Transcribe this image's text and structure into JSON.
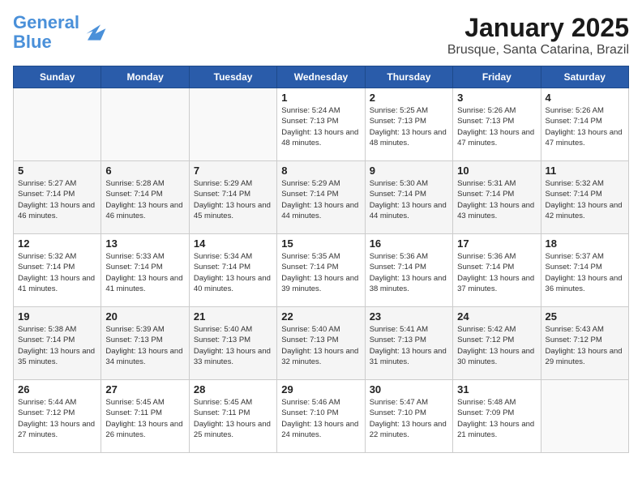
{
  "header": {
    "logo_line1": "General",
    "logo_line2": "Blue",
    "calendar_title": "January 2025",
    "calendar_subtitle": "Brusque, Santa Catarina, Brazil"
  },
  "weekdays": [
    "Sunday",
    "Monday",
    "Tuesday",
    "Wednesday",
    "Thursday",
    "Friday",
    "Saturday"
  ],
  "weeks": [
    [
      {
        "day": "",
        "sunrise": "",
        "sunset": "",
        "daylight": ""
      },
      {
        "day": "",
        "sunrise": "",
        "sunset": "",
        "daylight": ""
      },
      {
        "day": "",
        "sunrise": "",
        "sunset": "",
        "daylight": ""
      },
      {
        "day": "1",
        "sunrise": "Sunrise: 5:24 AM",
        "sunset": "Sunset: 7:13 PM",
        "daylight": "Daylight: 13 hours and 48 minutes."
      },
      {
        "day": "2",
        "sunrise": "Sunrise: 5:25 AM",
        "sunset": "Sunset: 7:13 PM",
        "daylight": "Daylight: 13 hours and 48 minutes."
      },
      {
        "day": "3",
        "sunrise": "Sunrise: 5:26 AM",
        "sunset": "Sunset: 7:13 PM",
        "daylight": "Daylight: 13 hours and 47 minutes."
      },
      {
        "day": "4",
        "sunrise": "Sunrise: 5:26 AM",
        "sunset": "Sunset: 7:14 PM",
        "daylight": "Daylight: 13 hours and 47 minutes."
      }
    ],
    [
      {
        "day": "5",
        "sunrise": "Sunrise: 5:27 AM",
        "sunset": "Sunset: 7:14 PM",
        "daylight": "Daylight: 13 hours and 46 minutes."
      },
      {
        "day": "6",
        "sunrise": "Sunrise: 5:28 AM",
        "sunset": "Sunset: 7:14 PM",
        "daylight": "Daylight: 13 hours and 46 minutes."
      },
      {
        "day": "7",
        "sunrise": "Sunrise: 5:29 AM",
        "sunset": "Sunset: 7:14 PM",
        "daylight": "Daylight: 13 hours and 45 minutes."
      },
      {
        "day": "8",
        "sunrise": "Sunrise: 5:29 AM",
        "sunset": "Sunset: 7:14 PM",
        "daylight": "Daylight: 13 hours and 44 minutes."
      },
      {
        "day": "9",
        "sunrise": "Sunrise: 5:30 AM",
        "sunset": "Sunset: 7:14 PM",
        "daylight": "Daylight: 13 hours and 44 minutes."
      },
      {
        "day": "10",
        "sunrise": "Sunrise: 5:31 AM",
        "sunset": "Sunset: 7:14 PM",
        "daylight": "Daylight: 13 hours and 43 minutes."
      },
      {
        "day": "11",
        "sunrise": "Sunrise: 5:32 AM",
        "sunset": "Sunset: 7:14 PM",
        "daylight": "Daylight: 13 hours and 42 minutes."
      }
    ],
    [
      {
        "day": "12",
        "sunrise": "Sunrise: 5:32 AM",
        "sunset": "Sunset: 7:14 PM",
        "daylight": "Daylight: 13 hours and 41 minutes."
      },
      {
        "day": "13",
        "sunrise": "Sunrise: 5:33 AM",
        "sunset": "Sunset: 7:14 PM",
        "daylight": "Daylight: 13 hours and 41 minutes."
      },
      {
        "day": "14",
        "sunrise": "Sunrise: 5:34 AM",
        "sunset": "Sunset: 7:14 PM",
        "daylight": "Daylight: 13 hours and 40 minutes."
      },
      {
        "day": "15",
        "sunrise": "Sunrise: 5:35 AM",
        "sunset": "Sunset: 7:14 PM",
        "daylight": "Daylight: 13 hours and 39 minutes."
      },
      {
        "day": "16",
        "sunrise": "Sunrise: 5:36 AM",
        "sunset": "Sunset: 7:14 PM",
        "daylight": "Daylight: 13 hours and 38 minutes."
      },
      {
        "day": "17",
        "sunrise": "Sunrise: 5:36 AM",
        "sunset": "Sunset: 7:14 PM",
        "daylight": "Daylight: 13 hours and 37 minutes."
      },
      {
        "day": "18",
        "sunrise": "Sunrise: 5:37 AM",
        "sunset": "Sunset: 7:14 PM",
        "daylight": "Daylight: 13 hours and 36 minutes."
      }
    ],
    [
      {
        "day": "19",
        "sunrise": "Sunrise: 5:38 AM",
        "sunset": "Sunset: 7:14 PM",
        "daylight": "Daylight: 13 hours and 35 minutes."
      },
      {
        "day": "20",
        "sunrise": "Sunrise: 5:39 AM",
        "sunset": "Sunset: 7:13 PM",
        "daylight": "Daylight: 13 hours and 34 minutes."
      },
      {
        "day": "21",
        "sunrise": "Sunrise: 5:40 AM",
        "sunset": "Sunset: 7:13 PM",
        "daylight": "Daylight: 13 hours and 33 minutes."
      },
      {
        "day": "22",
        "sunrise": "Sunrise: 5:40 AM",
        "sunset": "Sunset: 7:13 PM",
        "daylight": "Daylight: 13 hours and 32 minutes."
      },
      {
        "day": "23",
        "sunrise": "Sunrise: 5:41 AM",
        "sunset": "Sunset: 7:13 PM",
        "daylight": "Daylight: 13 hours and 31 minutes."
      },
      {
        "day": "24",
        "sunrise": "Sunrise: 5:42 AM",
        "sunset": "Sunset: 7:12 PM",
        "daylight": "Daylight: 13 hours and 30 minutes."
      },
      {
        "day": "25",
        "sunrise": "Sunrise: 5:43 AM",
        "sunset": "Sunset: 7:12 PM",
        "daylight": "Daylight: 13 hours and 29 minutes."
      }
    ],
    [
      {
        "day": "26",
        "sunrise": "Sunrise: 5:44 AM",
        "sunset": "Sunset: 7:12 PM",
        "daylight": "Daylight: 13 hours and 27 minutes."
      },
      {
        "day": "27",
        "sunrise": "Sunrise: 5:45 AM",
        "sunset": "Sunset: 7:11 PM",
        "daylight": "Daylight: 13 hours and 26 minutes."
      },
      {
        "day": "28",
        "sunrise": "Sunrise: 5:45 AM",
        "sunset": "Sunset: 7:11 PM",
        "daylight": "Daylight: 13 hours and 25 minutes."
      },
      {
        "day": "29",
        "sunrise": "Sunrise: 5:46 AM",
        "sunset": "Sunset: 7:10 PM",
        "daylight": "Daylight: 13 hours and 24 minutes."
      },
      {
        "day": "30",
        "sunrise": "Sunrise: 5:47 AM",
        "sunset": "Sunset: 7:10 PM",
        "daylight": "Daylight: 13 hours and 22 minutes."
      },
      {
        "day": "31",
        "sunrise": "Sunrise: 5:48 AM",
        "sunset": "Sunset: 7:09 PM",
        "daylight": "Daylight: 13 hours and 21 minutes."
      },
      {
        "day": "",
        "sunrise": "",
        "sunset": "",
        "daylight": ""
      }
    ]
  ]
}
